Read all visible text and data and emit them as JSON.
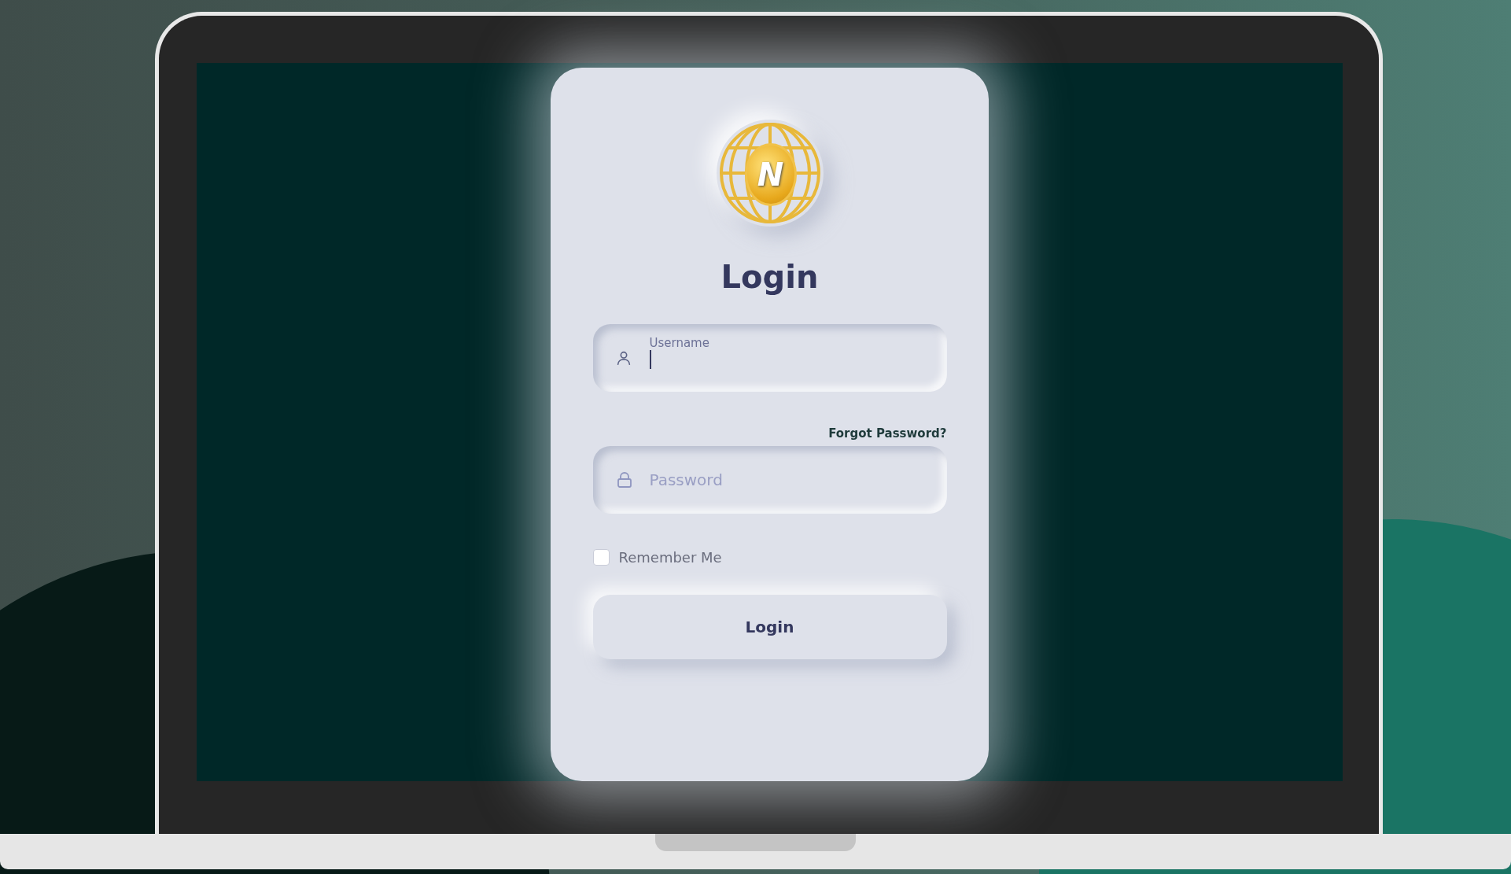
{
  "logo": {
    "letter": "N"
  },
  "title": "Login",
  "username": {
    "label": "Username",
    "focused": true
  },
  "forgot_link": "Forgot Password?",
  "password": {
    "placeholder": "Password"
  },
  "remember_me": {
    "label": "Remember Me",
    "checked": false
  },
  "login_button": "Login"
}
